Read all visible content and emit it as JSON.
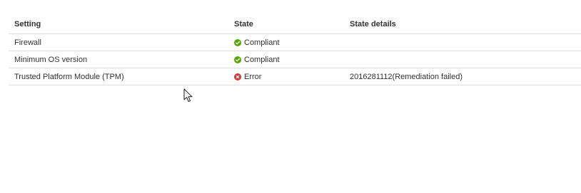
{
  "table": {
    "headers": {
      "setting": "Setting",
      "state": "State",
      "details": "State details"
    },
    "rows": [
      {
        "setting": "Firewall",
        "state": "Compliant",
        "status": "success",
        "details": ""
      },
      {
        "setting": "Minimum OS version",
        "state": "Compliant",
        "status": "success",
        "details": ""
      },
      {
        "setting": "Trusted Platform Module (TPM)",
        "state": "Error",
        "status": "error",
        "details": "2016281112(Remediation failed)"
      }
    ]
  },
  "colors": {
    "success": "#57a300",
    "error": "#d13438"
  },
  "icons": {
    "success": "check-circle-icon",
    "error": "error-circle-icon"
  }
}
